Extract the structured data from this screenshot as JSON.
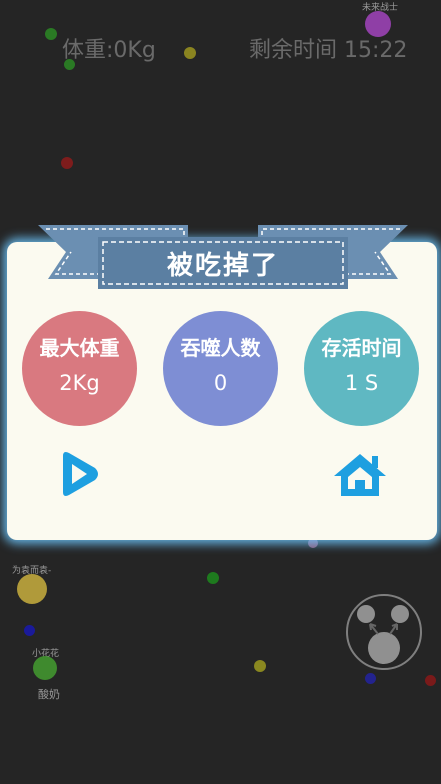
{
  "hud": {
    "weight": "体重:0Kg",
    "time_remaining": "剩余时间 15:22"
  },
  "dialog": {
    "title": "被吃掉了",
    "stats": [
      {
        "label": "最大体重",
        "value": "2Kg",
        "color": "#d97980"
      },
      {
        "label": "吞噬人数",
        "value": "0",
        "color": "#7e8ed4"
      },
      {
        "label": "存活时间",
        "value": "1 S",
        "color": "#5fb8c2"
      }
    ],
    "replay_icon": "play-icon",
    "home_icon": "home-icon"
  },
  "players": [
    {
      "name": "未来战士",
      "color": "#8f3fa6"
    },
    {
      "name": "为袁而袁-",
      "color": "#b09a3a"
    },
    {
      "name": "小花花",
      "color": "#3f8a2e"
    }
  ],
  "hint": "酸奶",
  "controls": {
    "split_button_icon": "split-icon"
  }
}
